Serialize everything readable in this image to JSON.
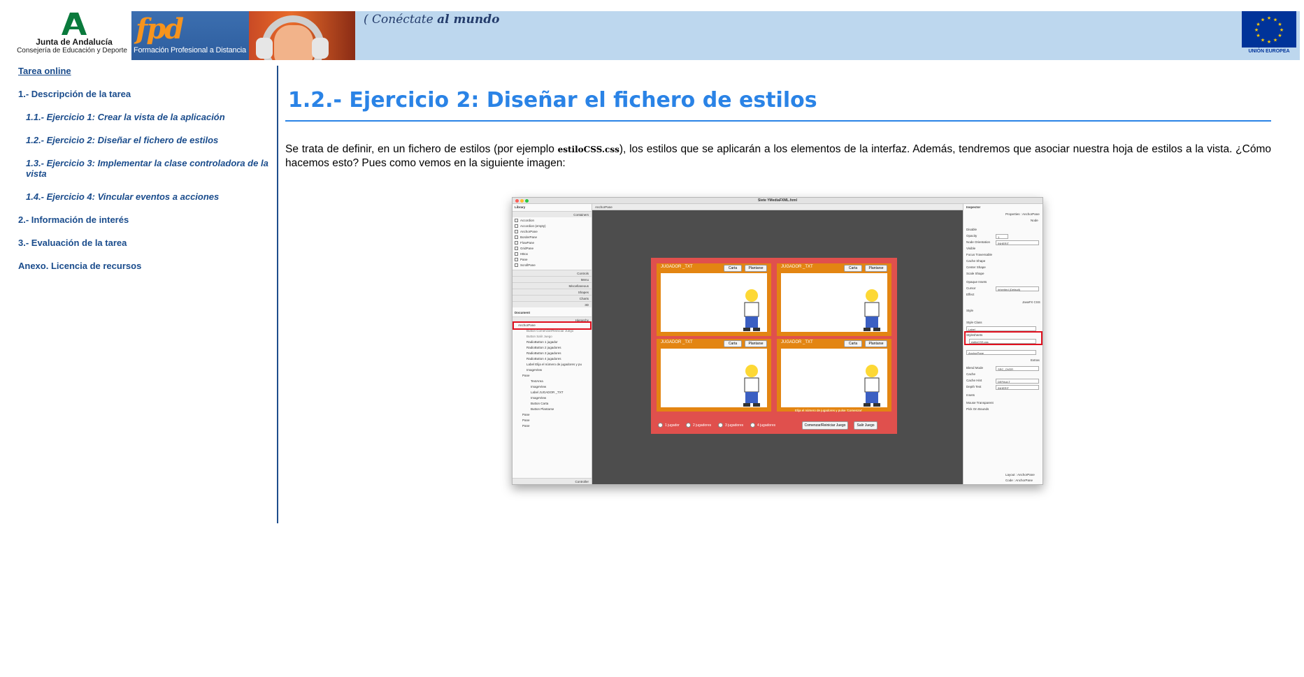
{
  "header": {
    "junta_line1": "Junta de Andalucía",
    "junta_line2": "Consejería de Educación y Deporte",
    "fpd_logo": "fpd",
    "fpd_text": "Formación Profesional a Distancia",
    "slogan_part1": "Conéctate",
    "slogan_part2": "al mundo",
    "eu_label": "UNIÓN EUROPEA",
    "colors": {
      "banner": "#bdd7ee",
      "fpd_blue": "#2d5d9e",
      "fpd_orange": "#f7941d",
      "eu_blue": "#003399",
      "junta_green": "#0a7a3c"
    }
  },
  "sidebar": {
    "items": [
      {
        "label": "Tarea online",
        "level": "top"
      },
      {
        "label": "1.- Descripción de la tarea",
        "level": "section"
      },
      {
        "label": "1.1.- Ejercicio 1: Crear la vista de la aplicación",
        "level": "sub"
      },
      {
        "label": "1.2.- Ejercicio 2: Diseñar el fichero de estilos",
        "level": "sub"
      },
      {
        "label": "1.3.- Ejercicio 3: Implementar la clase controladora de la vista",
        "level": "sub"
      },
      {
        "label": "1.4.- Ejercicio 4: Vincular eventos a acciones",
        "level": "sub"
      },
      {
        "label": "2.- Información de interés",
        "level": "section"
      },
      {
        "label": "3.- Evaluación de la tarea",
        "level": "section"
      },
      {
        "label": "Anexo. Licencia de recursos",
        "level": "section"
      }
    ],
    "colors": {
      "link": "#1a4c8c",
      "rule": "#1f4e8c"
    }
  },
  "main": {
    "title": "1.2.- Ejercicio 2: Diseñar el fichero de estilos",
    "para_before_code": "Se trata de definir, en un fichero de estilos (por ejemplo ",
    "para_code": "estiloCSS.css",
    "para_after_code": "), los estilos que se aplicarán a los elementos de la interfaz. Además, tendremos que asociar nuestra hoja de estilos a la vista. ¿Cómo hacemos esto? Pues como vemos en la siguiente imagen:",
    "colors": {
      "title": "#2a83e6"
    }
  },
  "screenshot": {
    "window_title": "Siete YMediaFXML.fxml",
    "library_title": "Library",
    "library_items": [
      "Accordion",
      "Accordion (empty)",
      "AnchorPane",
      "BorderPane",
      "FlowPane",
      "GridPane",
      "HBox",
      "Pane",
      "ScrollPane"
    ],
    "library_sections": [
      "Containers",
      "Controls",
      "Menu",
      "Miscellaneous",
      "Shapes",
      "Charts",
      "3D"
    ],
    "document_title": "Document",
    "hierarchy_title": "Hierarchy",
    "hierarchy_items": [
      "AnchorPane",
      "Button  Comenzar/Reiniciar Juego",
      "Button  Salir Juego",
      "RadioButton  1 jugador",
      "RadioButton  2 jugadores",
      "RadioButton  3 jugadores",
      "RadioButton  4 jugadores",
      "Label  Elija el número de jugadores y pu",
      "ImageView",
      "Pane",
      "TextArea",
      "ImageView",
      "Label  JUGADOR _TXT",
      "ImageView",
      "Button  Carta",
      "Button  Plantarse",
      "Pane",
      "Pane",
      "Pane"
    ],
    "controller_label": "Controller",
    "canvas_breadcrumb": "AnchorPane",
    "player_label": "JUGADOR _TXT",
    "btn_carta": "Carta",
    "btn_plantarse": "Plantarse",
    "game_note": "Elija el número de jugadores y pulse 'Comenzar'",
    "radios": [
      "1 jugador",
      "2 jugadores",
      "3 jugadores",
      "4 jugadores"
    ],
    "btn_start": "Comenzar/Reiniciar Juego",
    "btn_exit": "Salir Juego",
    "inspector_title": "Inspector",
    "inspector_properties": "Properties : AnchorPane",
    "inspector_node": "Node",
    "inspector_rows": [
      "Disable",
      "Opacity",
      "Node Orientation",
      "Visible",
      "Focus Traversable",
      "Cache Shape",
      "Center Shape",
      "Scale Shape",
      "Opaque Insets",
      "Cursor",
      "Effect"
    ],
    "inspector_values": {
      "opacity": "1",
      "orientation": "INHERIT",
      "cursor": "Inherited (Default)"
    },
    "javafx_css": "JavaFX CSS",
    "style_label": "Style",
    "style_class_label": "Style Class",
    "style_class_value": "Label",
    "stylesheets_label": "Stylesheets",
    "stylesheets_value": "estiloCSS.css",
    "id_value": "AnchorPane",
    "extras_label": "Extras",
    "extra_rows": [
      "Blend Mode",
      "Cache",
      "Cache Hint",
      "Depth Test",
      "Insets",
      "Mouse Transparent",
      "Pick On Bounds"
    ],
    "extra_values": {
      "blend": "SRC_OVER",
      "cache_hint": "DEFAULT",
      "depth": "INHERIT"
    },
    "layout_footer": "Layout : AnchorPane",
    "code_footer": "Code : AnchorPane",
    "colors": {
      "canvas": "#4d4d4d",
      "game_bg": "#e0504d",
      "card": "#e38512",
      "highlight": "#e0101e"
    }
  }
}
